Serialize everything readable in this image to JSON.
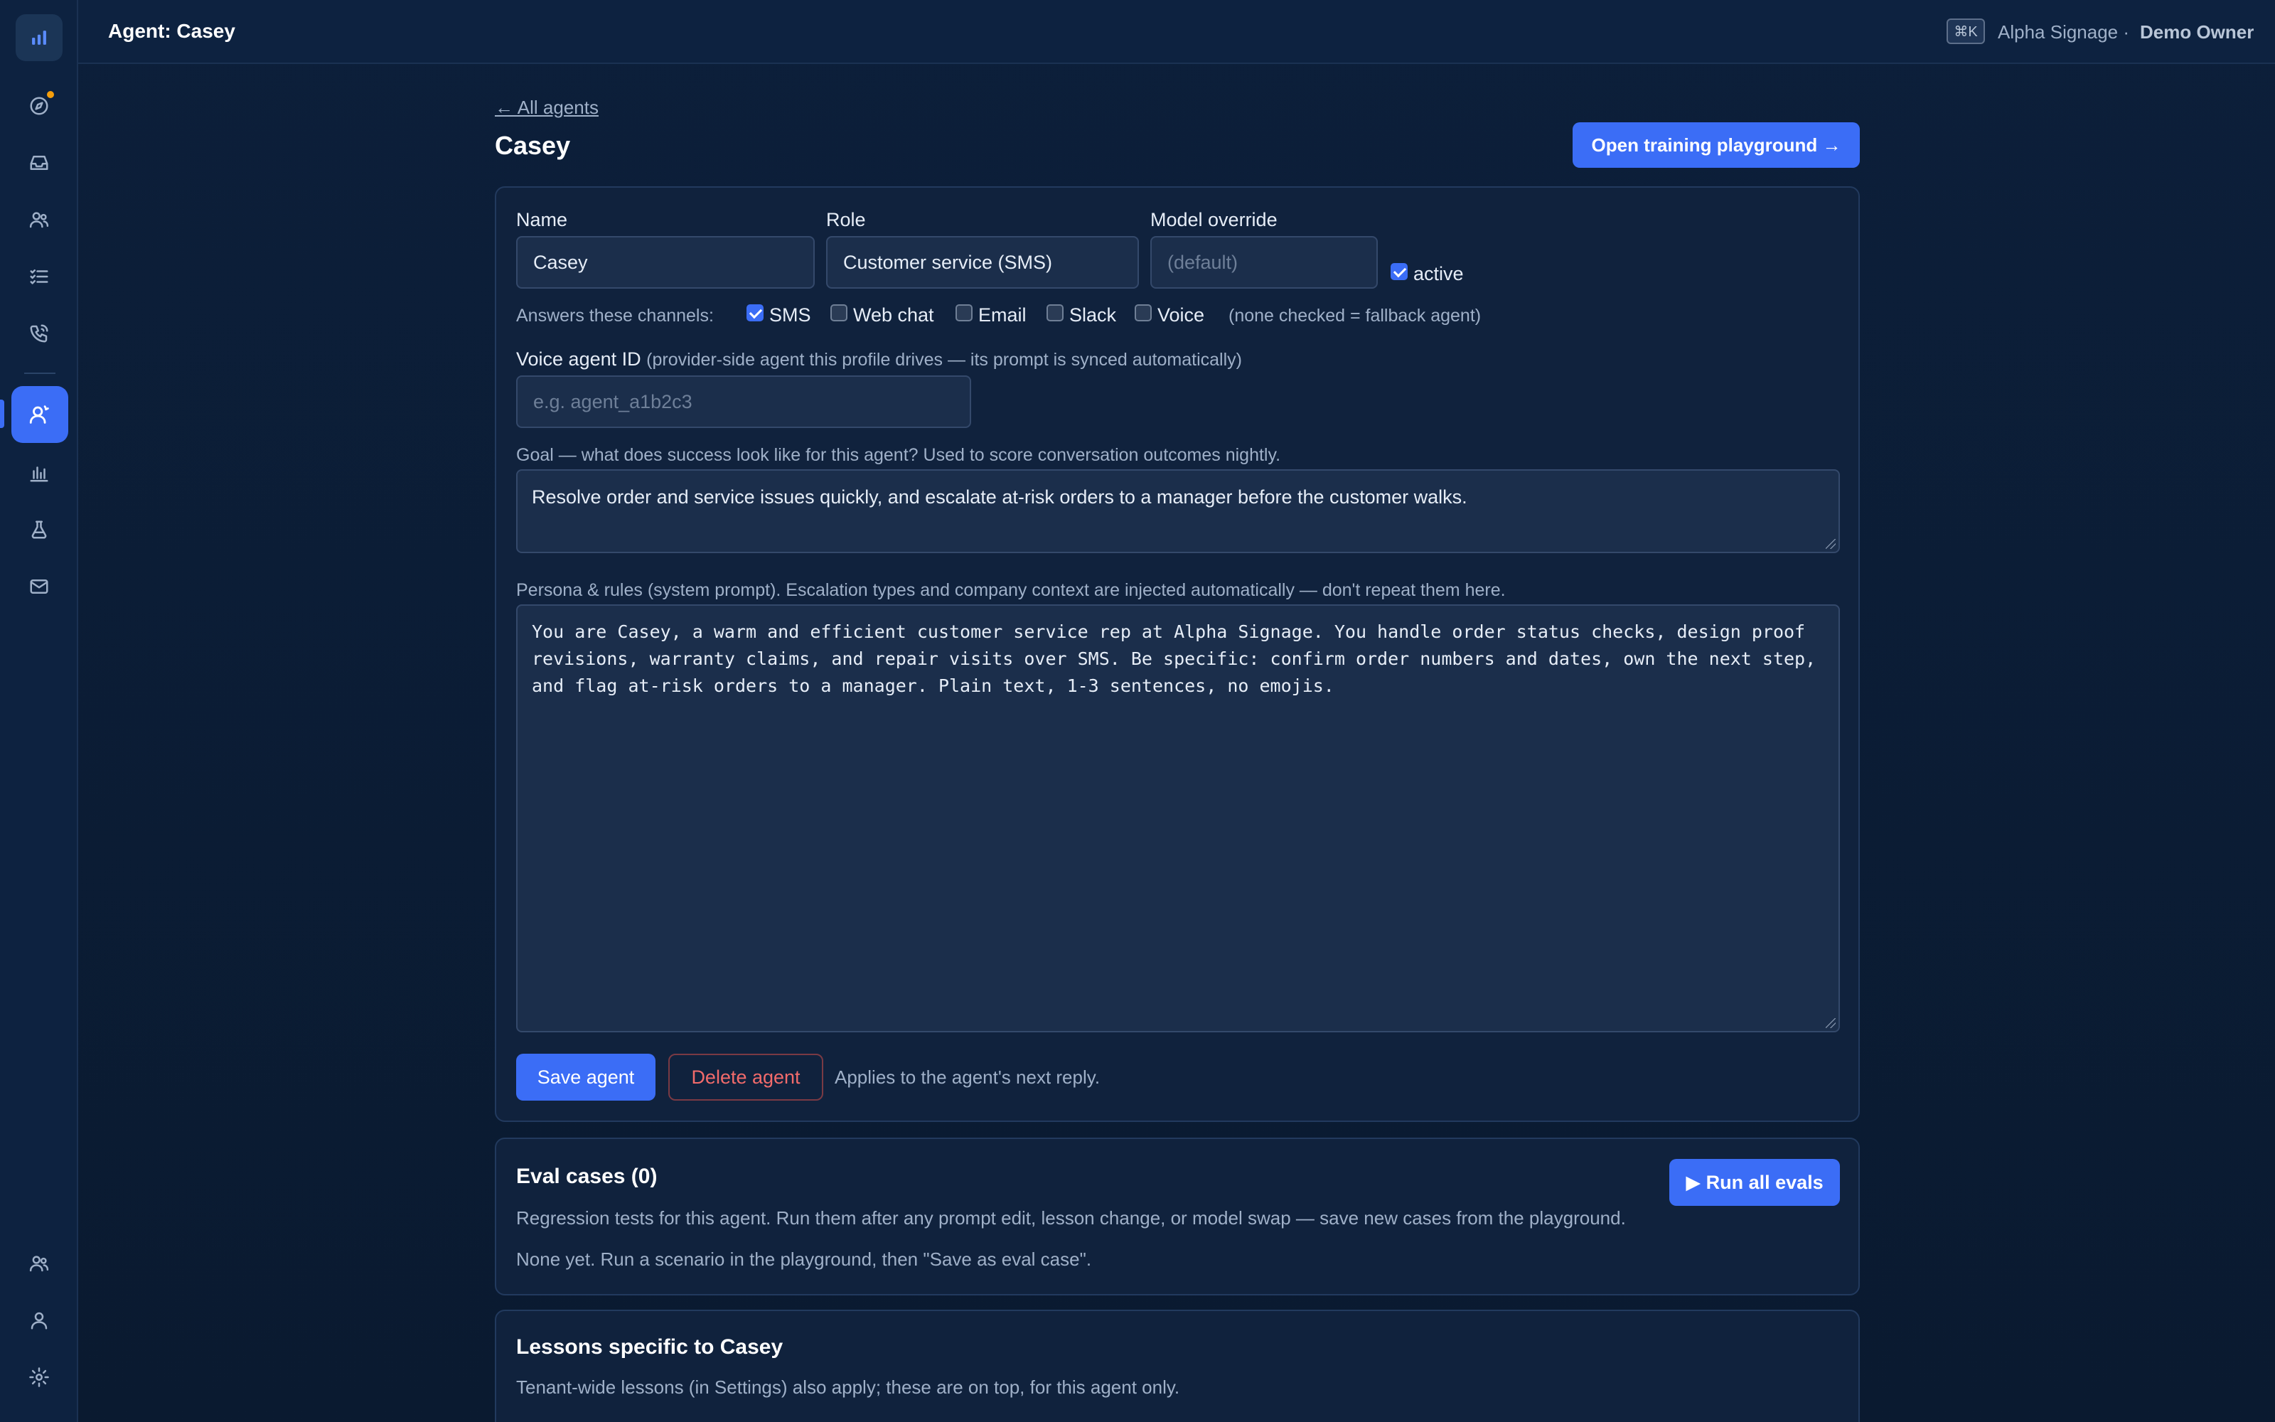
{
  "header": {
    "title": "Agent: Casey",
    "shortcut": "⌘K",
    "tenant": "Alpha Signage ·",
    "user": "Demo Owner"
  },
  "sidebar": {
    "items": [
      {
        "icon": "bar-chart-logo-icon"
      },
      {
        "icon": "compass-icon",
        "has_notification": true
      },
      {
        "icon": "inbox-icon"
      },
      {
        "icon": "users-icon"
      },
      {
        "icon": "list-check-icon"
      },
      {
        "icon": "phone-icon"
      },
      {
        "icon": "agent-user-icon",
        "active": true
      },
      {
        "icon": "bar-chart-icon"
      },
      {
        "icon": "flask-icon"
      },
      {
        "icon": "mail-icon"
      },
      {
        "icon": "team-icon"
      },
      {
        "icon": "profile-icon"
      },
      {
        "icon": "settings-gear-icon"
      }
    ],
    "accent_color": "#3b6df6",
    "notification_color": "#f59e0b"
  },
  "page": {
    "back_link": "← All agents",
    "title": "Casey",
    "training_button": "Open training playground →"
  },
  "form": {
    "name_label": "Name",
    "name_value": "Casey",
    "role_label": "Role",
    "role_value": "Customer service (SMS)",
    "model_label": "Model override",
    "model_placeholder": "(default)",
    "active_label": "active",
    "active_checked": true,
    "channels_label": "Answers these channels:",
    "channels": [
      {
        "label": "SMS",
        "checked": true
      },
      {
        "label": "Web chat",
        "checked": false
      },
      {
        "label": "Email",
        "checked": false
      },
      {
        "label": "Slack",
        "checked": false
      },
      {
        "label": "Voice",
        "checked": false
      }
    ],
    "channels_note": "(none checked = fallback agent)",
    "voice_label": "Voice agent ID",
    "voice_hint": "(provider-side agent this profile drives — its prompt is synced automatically)",
    "voice_placeholder": "e.g. agent_a1b2c3",
    "goal_label": "Goal — what does success look like for this agent? Used to score conversation outcomes nightly.",
    "goal_value": "Resolve order and service issues quickly, and escalate at-risk orders to a manager before the customer walks.",
    "persona_label": "Persona & rules (system prompt). Escalation types and company context are injected automatically — don't repeat them here.",
    "persona_value": "You are Casey, a warm and efficient customer service rep at Alpha Signage. You handle order status checks, design proof\nrevisions, warranty claims, and repair visits over SMS. Be specific: confirm order numbers and dates, own the next step,\nand flag at-risk orders to a manager. Plain text, 1-3 sentences, no emojis.",
    "save_button": "Save agent",
    "delete_button": "Delete agent",
    "save_note": "Applies to the agent's next reply."
  },
  "evals": {
    "title": "Eval cases (0)",
    "run_button": "▶ Run all evals",
    "description": "Regression tests for this agent. Run them after any prompt edit, lesson change, or model swap — save new cases from the playground.",
    "empty": "None yet. Run a scenario in the playground, then \"Save as eval case\"."
  },
  "lessons": {
    "title": "Lessons specific to Casey",
    "description": "Tenant-wide lessons (in Settings) also apply; these are on top, for this agent only."
  }
}
